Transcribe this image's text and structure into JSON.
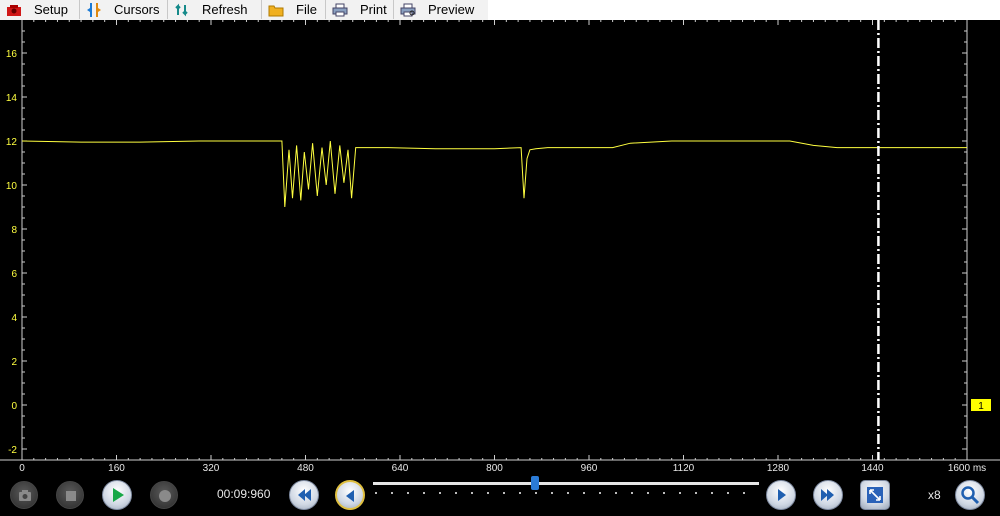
{
  "toolbar": {
    "items": [
      {
        "label": "Setup",
        "icon": "setup-icon"
      },
      {
        "label": "Cursors",
        "icon": "cursors-icon"
      },
      {
        "label": "Refresh",
        "icon": "refresh-icon"
      },
      {
        "label": "File",
        "icon": "folder-icon"
      },
      {
        "label": "Print",
        "icon": "printer-icon"
      },
      {
        "label": "Preview",
        "icon": "print-preview-icon"
      }
    ]
  },
  "chart_data": {
    "type": "line",
    "title": "",
    "xlabel": "",
    "ylabel": "",
    "x_unit": "ms",
    "xlim": [
      0,
      1600
    ],
    "ylim": [
      -2.5,
      17.5
    ],
    "x_ticks": [
      "0",
      "160",
      "320",
      "480",
      "640",
      "800",
      "960",
      "1120",
      "1280",
      "1440",
      "1600 ms"
    ],
    "y_ticks": [
      "16",
      "14",
      "12",
      "10",
      "8",
      "6",
      "4",
      "2",
      "0",
      "-2"
    ],
    "channel_marker": "1",
    "cursor_x": 1450,
    "grid": false,
    "colors": {
      "trace": "#ffff40",
      "axis_text": "#ffff40",
      "background": "#000000",
      "cursor": "#ffffff"
    },
    "series": [
      {
        "x": [
          0,
          100,
          200,
          300,
          375,
          440,
          445,
          452,
          458,
          465,
          472,
          478,
          485,
          492,
          500,
          508,
          515,
          522,
          530,
          538,
          545,
          552,
          558,
          565,
          580,
          620,
          700,
          800,
          845,
          850,
          855,
          860,
          870,
          890,
          920,
          1000,
          1030,
          1100,
          1200,
          1300,
          1340,
          1380,
          1450,
          1500,
          1600
        ],
        "y": [
          12.0,
          11.95,
          11.95,
          12.0,
          12.0,
          12.0,
          9.0,
          11.6,
          9.4,
          11.8,
          9.3,
          11.5,
          9.8,
          11.9,
          9.5,
          11.7,
          10.0,
          12.0,
          9.6,
          11.8,
          10.1,
          11.6,
          9.4,
          11.7,
          11.7,
          11.7,
          11.65,
          11.65,
          11.7,
          9.4,
          11.2,
          11.6,
          11.65,
          11.7,
          11.7,
          11.7,
          11.9,
          12.0,
          12.0,
          12.0,
          11.8,
          11.7,
          11.7,
          11.7,
          11.7
        ]
      }
    ]
  },
  "controls": {
    "timecode": "00:09:960",
    "zoom_label": "x8",
    "scrub_position": 0.42,
    "buttons": [
      "camera-icon",
      "stop-icon",
      "play-icon",
      "record-icon",
      "skip-back-icon",
      "step-back-icon",
      "step-forward-icon",
      "skip-forward-icon",
      "zoom-fit-icon",
      "magnifier-icon"
    ]
  }
}
